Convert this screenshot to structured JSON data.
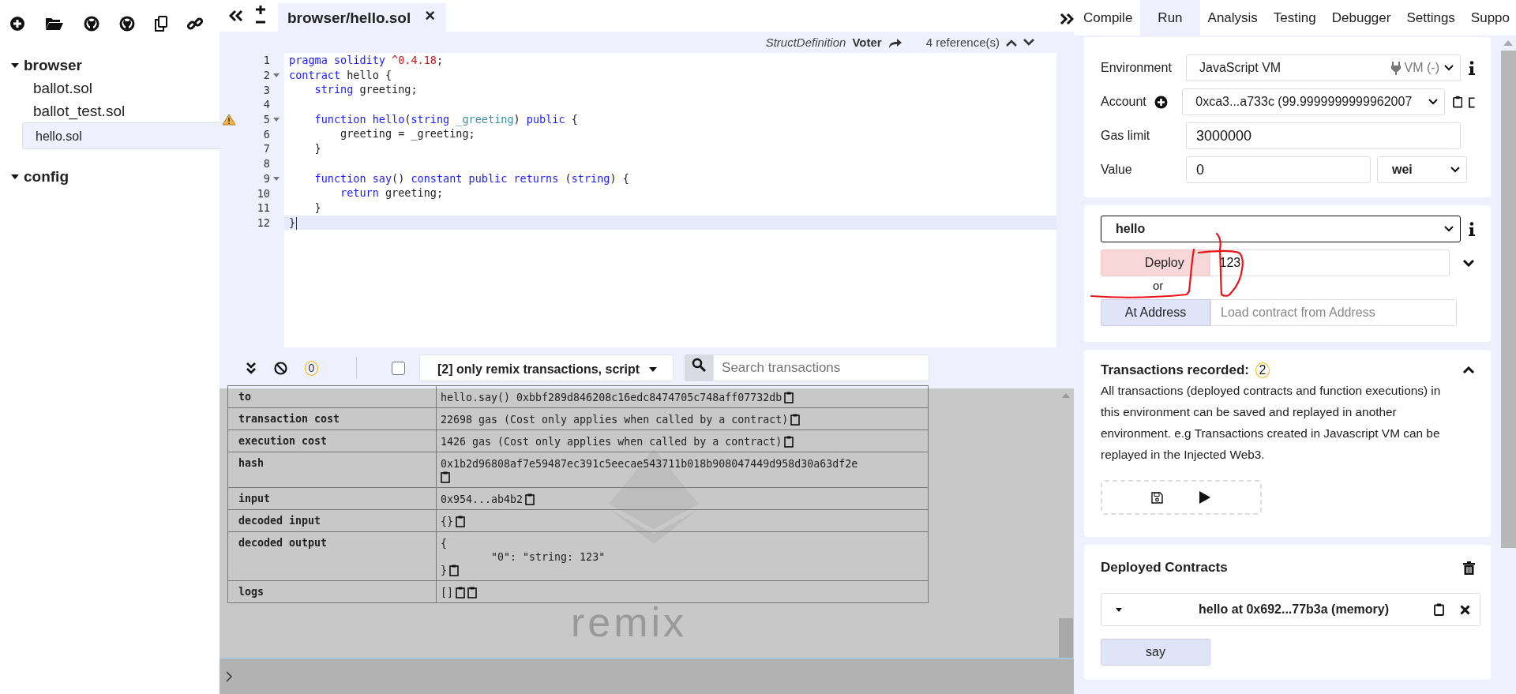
{
  "file_tree": [
    {
      "label": "browser",
      "expanded": true,
      "children": [
        {
          "label": "ballot.sol",
          "selected": false
        },
        {
          "label": "ballot_test.sol",
          "selected": false
        },
        {
          "label": "hello.sol",
          "selected": true
        }
      ]
    },
    {
      "label": "config",
      "expanded": true
    }
  ],
  "editor": {
    "tab": {
      "label": "browser/hello.sol",
      "close": "×"
    },
    "reference_bar": {
      "type": "StructDefinition",
      "name": "Voter",
      "references": "4 reference(s)"
    },
    "lines": [
      {
        "number": "1",
        "fold": false,
        "warning": false,
        "current": false,
        "tokens": [
          {
            "text": "pragma solidity ",
            "kind": "keyword"
          },
          {
            "text": "^0.4.18",
            "kind": "number"
          },
          {
            "text": ";",
            "kind": "plain"
          }
        ]
      },
      {
        "number": "2",
        "fold": true,
        "warning": false,
        "current": false,
        "tokens": [
          {
            "text": "contract",
            "kind": "keyword"
          },
          {
            "text": " hello {",
            "kind": "plain"
          }
        ]
      },
      {
        "number": "3",
        "fold": false,
        "warning": false,
        "current": false,
        "tokens": [
          {
            "text": "    string",
            "kind": "keyword"
          },
          {
            "text": " greeting;",
            "kind": "plain"
          }
        ]
      },
      {
        "number": "4",
        "fold": false,
        "warning": false,
        "current": false
      },
      {
        "number": "5",
        "fold": true,
        "warning": true,
        "current": false,
        "tokens": [
          {
            "text": "    function hello",
            "kind": "keyword"
          },
          {
            "text": "(",
            "kind": "plain"
          },
          {
            "text": "string ",
            "kind": "keyword"
          },
          {
            "text": "_greeting",
            "kind": "param"
          },
          {
            "text": ") ",
            "kind": "plain"
          },
          {
            "text": "public",
            "kind": "keyword"
          },
          {
            "text": " {",
            "kind": "plain"
          }
        ]
      },
      {
        "number": "6",
        "fold": false,
        "warning": false,
        "current": false,
        "tokens": [
          {
            "text": "        greeting = _greeting;",
            "kind": "plain"
          }
        ]
      },
      {
        "number": "7",
        "fold": false,
        "warning": false,
        "current": false,
        "tokens": [
          {
            "text": "    }",
            "kind": "plain"
          }
        ]
      },
      {
        "number": "8",
        "fold": false,
        "warning": false,
        "current": false
      },
      {
        "number": "9",
        "fold": true,
        "warning": false,
        "current": false,
        "tokens": [
          {
            "text": "    function say",
            "kind": "keyword"
          },
          {
            "text": "() ",
            "kind": "plain"
          },
          {
            "text": "constant public returns",
            "kind": "keyword"
          },
          {
            "text": " (",
            "kind": "plain"
          },
          {
            "text": "string",
            "kind": "keyword"
          },
          {
            "text": ") {",
            "kind": "plain"
          }
        ]
      },
      {
        "number": "10",
        "fold": false,
        "warning": false,
        "current": false,
        "tokens": [
          {
            "text": "        return",
            "kind": "keyword"
          },
          {
            "text": " greeting;",
            "kind": "plain"
          }
        ]
      },
      {
        "number": "11",
        "fold": false,
        "warning": false,
        "current": false,
        "tokens": [
          {
            "text": "    }",
            "kind": "plain"
          }
        ]
      },
      {
        "number": "12",
        "fold": false,
        "warning": false,
        "current": true,
        "tokens": [
          {
            "text": "}",
            "kind": "plain"
          }
        ]
      }
    ]
  },
  "terminal": {
    "pending_count": "0",
    "filter_checked": false,
    "filter": "[2] only remix transactions, script",
    "search": {
      "placeholder": "Search transactions"
    },
    "logo": "remix",
    "rows": [
      {
        "key": "to",
        "kind": "single",
        "value": [
          "hello.say() 0xbbf289d846208c16edc8474705c748aff07732db"
        ]
      },
      {
        "key": "transaction cost",
        "kind": "single",
        "value": [
          "22698 gas (Cost only applies when called by a contract)"
        ]
      },
      {
        "key": "execution cost",
        "kind": "single",
        "value": [
          "1426 gas (Cost only applies when called by a contract)"
        ]
      },
      {
        "key": "hash",
        "kind": "wrapped",
        "value": [
          "0x1b2d96808af7e59487ec391c5eecae543711b018b908047449d958d30a63df2e"
        ]
      },
      {
        "key": "input",
        "kind": "single",
        "value": [
          "0x954...ab4b2"
        ]
      },
      {
        "key": "decoded input",
        "kind": "single",
        "value": [
          "{}"
        ]
      },
      {
        "key": "decoded output",
        "kind": "single",
        "value": [
          "{",
          "        \"0\": \"string: 123\"",
          "}"
        ]
      },
      {
        "key": "logs",
        "kind": "double",
        "value": [
          "[]"
        ]
      }
    ]
  },
  "run_panel": {
    "tabs": [
      {
        "label": "Compile",
        "selected": false
      },
      {
        "label": "Run",
        "selected": true
      },
      {
        "label": "Analysis",
        "selected": false
      },
      {
        "label": "Testing",
        "selected": false
      },
      {
        "label": "Debugger",
        "selected": false
      },
      {
        "label": "Settings",
        "selected": false
      },
      {
        "label": "Suppo",
        "selected": false
      }
    ],
    "environment": {
      "label": "Environment",
      "value": "JavaScript VM",
      "provider": "VM (-)"
    },
    "account": {
      "label": "Account",
      "value": "0xca3...a733c (99.9999999999962007"
    },
    "gas_limit": {
      "label": "Gas limit",
      "value": "3000000"
    },
    "value": {
      "label": "Value",
      "value": "0",
      "unit": "wei"
    },
    "contract": "hello",
    "deploy": {
      "button": "Deploy",
      "args": "123"
    },
    "or": "or",
    "at_address": {
      "button": "At Address",
      "placeholder": "Load contract from Address"
    },
    "transactions": {
      "title": "Transactions recorded:",
      "count": "2",
      "expanded": true,
      "description": "All transactions (deployed contracts and function executions) in this environment can be saved and replayed in another environment. e.g Transactions created in Javascript VM can be replayed in the Injected Web3."
    },
    "deployed": {
      "title": "Deployed Contracts",
      "instance": "hello at 0x692...77b3a (memory)",
      "functions": [
        "say"
      ]
    }
  }
}
